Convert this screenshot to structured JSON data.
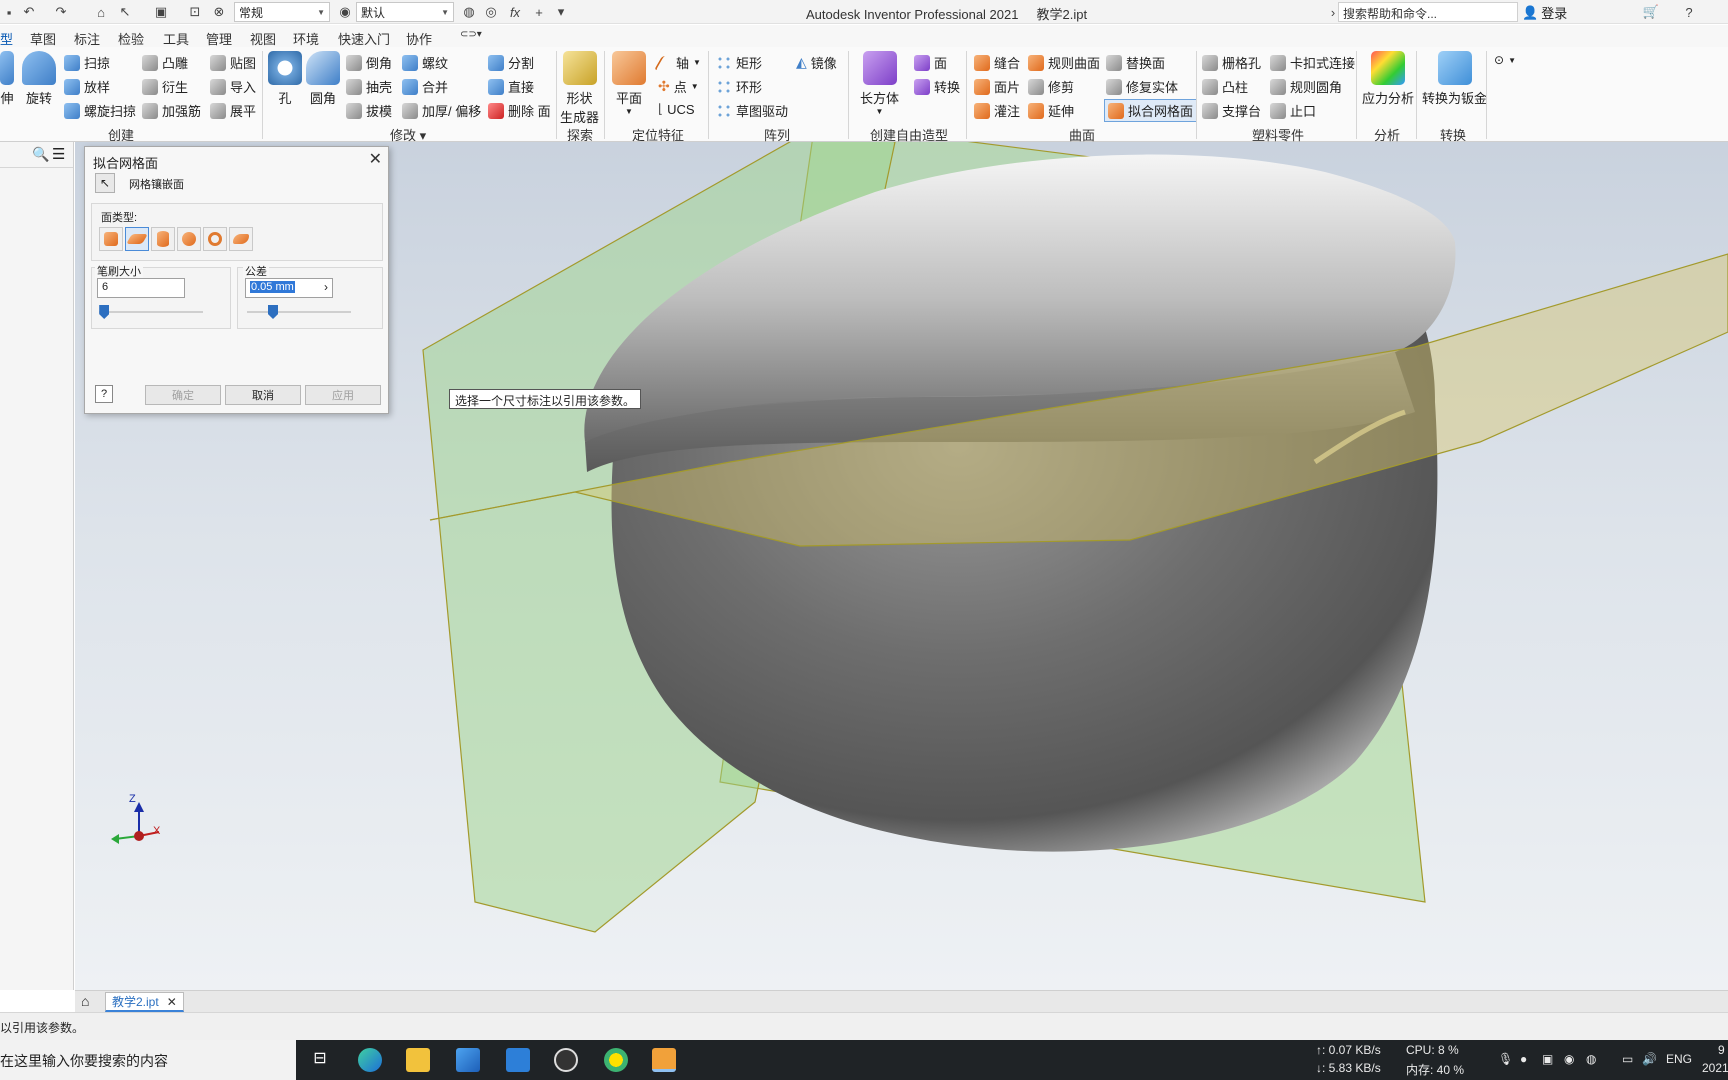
{
  "title_bar": {
    "qat_style_combo": "常规",
    "qat_appearance_combo": "默认",
    "app_title": "Autodesk Inventor Professional 2021",
    "doc_title": "教学2.ipt",
    "help_search_placeholder": "搜索帮助和命令...",
    "login": "登录"
  },
  "ribbon_tabs": [
    "型",
    "草图",
    "标注",
    "检验",
    "工具",
    "管理",
    "视图",
    "环境",
    "快速入门",
    "协作"
  ],
  "ribbon": {
    "create": {
      "label": "创建",
      "stretch": "伸",
      "revolve": "旋转",
      "sweep": "扫掠",
      "loft": "放样",
      "coil": "螺旋扫掠",
      "emboss": "凸雕",
      "derive": "衍生",
      "rib": "加强筋",
      "decal": "贴图",
      "import": "导入",
      "unfold": "展平"
    },
    "modify": {
      "label": "修改",
      "hole": "孔",
      "fillet": "圆角",
      "chamfer": "倒角",
      "shell": "抽壳",
      "draft": "拔模",
      "thread": "螺纹",
      "combine": "合并",
      "thicken": "加厚/ 偏移",
      "split": "分割",
      "direct": "直接",
      "delete_face": "删除 面"
    },
    "explore": {
      "label": "探索",
      "shape_generator_1": "形状",
      "shape_generator_2": "生成器"
    },
    "work_features": {
      "label": "定位特征",
      "plane": "平面",
      "axis": "轴",
      "point": "点",
      "ucs": "UCS"
    },
    "pattern": {
      "label": "阵列",
      "rectangular": "矩形",
      "circular": "环形",
      "sketch_driven": "草图驱动",
      "mirror": "镜像"
    },
    "freeform": {
      "label": "创建自由造型",
      "box": "长方体",
      "face": "面",
      "convert": "转换"
    },
    "surface": {
      "label": "曲面",
      "stitch": "缝合",
      "patch": "面片",
      "sculpt": "灌注",
      "ruled": "规则曲面",
      "trim": "修剪",
      "extend": "延伸",
      "replace_face": "替换面",
      "repair": "修复实体",
      "fit_mesh": "拟合网格面"
    },
    "plastic": {
      "label": "塑料零件",
      "grill": "栅格孔",
      "boss": "凸柱",
      "rest": "支撑台",
      "snap_fit": "卡扣式连接",
      "rule_fillet": "规则圆角",
      "lip": "止口"
    },
    "analysis": {
      "label": "分析",
      "stress": "应力分析"
    },
    "convert": {
      "label": "转换",
      "to_sheetmetal": "转换为钣金"
    }
  },
  "dialog": {
    "title": "拟合网格面",
    "mesh_face": "网格镶嵌面",
    "face_type_label": "面类型:",
    "brush_size_label": "笔刷大小",
    "brush_size_value": "6",
    "tolerance_label": "公差",
    "tolerance_value": "0.05 mm",
    "brush_slider_level": 0.05,
    "tolerance_slider_level": 0.25,
    "ok": "确定",
    "cancel": "取消",
    "apply": "应用"
  },
  "tooltip": "选择一个尺寸标注以引用该参数。",
  "doc_tab": "教学2.ipt",
  "status_text": "以引用该参数。",
  "taskbar": {
    "search_placeholder": "在这里输入你要搜索的内容",
    "net_up": "↑: 0.07 KB/s",
    "net_down": "↓: 5.83 KB/s",
    "cpu": "CPU: 8 %",
    "memory": "内存: 40 %",
    "lang": "ENG",
    "time_partial": "9",
    "date_partial": "2021"
  },
  "viewcube_axes": {
    "z": "Z",
    "x": "X"
  },
  "colors": {
    "accent": "#2a6fc0",
    "plane_green": "#9ed38b",
    "plane_yellow": "#d8c06a"
  }
}
